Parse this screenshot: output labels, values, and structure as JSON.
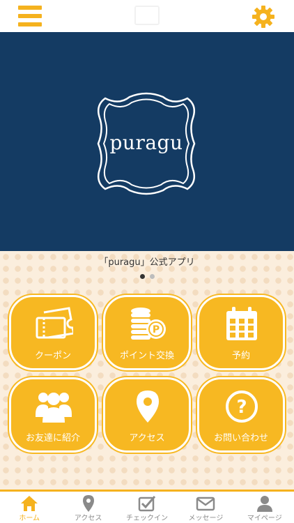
{
  "header": {
    "menu_icon": "hamburger-menu-icon",
    "settings_icon": "gear-icon",
    "accent_color": "#f5b21e"
  },
  "hero": {
    "logo_text": "puragu",
    "background_color": "#143b63"
  },
  "caption": "「puragu」公式アプリ",
  "carousel": {
    "page_count": 2,
    "active_index": 0
  },
  "tiles": [
    {
      "label": "クーポン",
      "icon": "ticket-icon"
    },
    {
      "label": "ポイント交換",
      "icon": "coins-icon"
    },
    {
      "label": "予約",
      "icon": "calendar-icon"
    },
    {
      "label": "お友達に紹介",
      "icon": "people-icon"
    },
    {
      "label": "アクセス",
      "icon": "map-pin-icon"
    },
    {
      "label": "お問い合わせ",
      "icon": "question-icon"
    }
  ],
  "bottom_nav": [
    {
      "label": "ホーム",
      "icon": "home-icon",
      "active": true
    },
    {
      "label": "アクセス",
      "icon": "map-pin-icon",
      "active": false
    },
    {
      "label": "チェックイン",
      "icon": "checkin-icon",
      "active": false
    },
    {
      "label": "メッセージ",
      "icon": "mail-icon",
      "active": false
    },
    {
      "label": "マイページ",
      "icon": "user-icon",
      "active": false
    }
  ]
}
